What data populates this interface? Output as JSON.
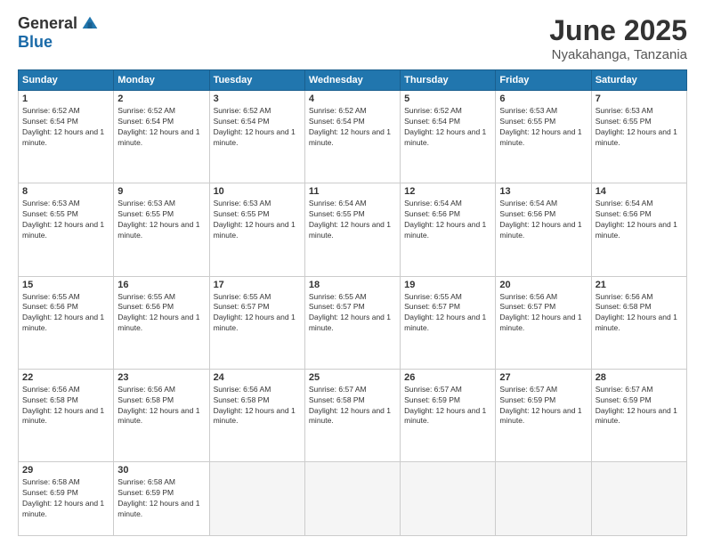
{
  "logo": {
    "general": "General",
    "blue": "Blue"
  },
  "title": "June 2025",
  "location": "Nyakahanga, Tanzania",
  "headers": [
    "Sunday",
    "Monday",
    "Tuesday",
    "Wednesday",
    "Thursday",
    "Friday",
    "Saturday"
  ],
  "weeks": [
    [
      {
        "day": "1",
        "sunrise": "6:52 AM",
        "sunset": "6:54 PM",
        "daylight": "12 hours and 1 minute."
      },
      {
        "day": "2",
        "sunrise": "6:52 AM",
        "sunset": "6:54 PM",
        "daylight": "12 hours and 1 minute."
      },
      {
        "day": "3",
        "sunrise": "6:52 AM",
        "sunset": "6:54 PM",
        "daylight": "12 hours and 1 minute."
      },
      {
        "day": "4",
        "sunrise": "6:52 AM",
        "sunset": "6:54 PM",
        "daylight": "12 hours and 1 minute."
      },
      {
        "day": "5",
        "sunrise": "6:52 AM",
        "sunset": "6:54 PM",
        "daylight": "12 hours and 1 minute."
      },
      {
        "day": "6",
        "sunrise": "6:53 AM",
        "sunset": "6:55 PM",
        "daylight": "12 hours and 1 minute."
      },
      {
        "day": "7",
        "sunrise": "6:53 AM",
        "sunset": "6:55 PM",
        "daylight": "12 hours and 1 minute."
      }
    ],
    [
      {
        "day": "8",
        "sunrise": "6:53 AM",
        "sunset": "6:55 PM",
        "daylight": "12 hours and 1 minute."
      },
      {
        "day": "9",
        "sunrise": "6:53 AM",
        "sunset": "6:55 PM",
        "daylight": "12 hours and 1 minute."
      },
      {
        "day": "10",
        "sunrise": "6:53 AM",
        "sunset": "6:55 PM",
        "daylight": "12 hours and 1 minute."
      },
      {
        "day": "11",
        "sunrise": "6:54 AM",
        "sunset": "6:55 PM",
        "daylight": "12 hours and 1 minute."
      },
      {
        "day": "12",
        "sunrise": "6:54 AM",
        "sunset": "6:56 PM",
        "daylight": "12 hours and 1 minute."
      },
      {
        "day": "13",
        "sunrise": "6:54 AM",
        "sunset": "6:56 PM",
        "daylight": "12 hours and 1 minute."
      },
      {
        "day": "14",
        "sunrise": "6:54 AM",
        "sunset": "6:56 PM",
        "daylight": "12 hours and 1 minute."
      }
    ],
    [
      {
        "day": "15",
        "sunrise": "6:55 AM",
        "sunset": "6:56 PM",
        "daylight": "12 hours and 1 minute."
      },
      {
        "day": "16",
        "sunrise": "6:55 AM",
        "sunset": "6:56 PM",
        "daylight": "12 hours and 1 minute."
      },
      {
        "day": "17",
        "sunrise": "6:55 AM",
        "sunset": "6:57 PM",
        "daylight": "12 hours and 1 minute."
      },
      {
        "day": "18",
        "sunrise": "6:55 AM",
        "sunset": "6:57 PM",
        "daylight": "12 hours and 1 minute."
      },
      {
        "day": "19",
        "sunrise": "6:55 AM",
        "sunset": "6:57 PM",
        "daylight": "12 hours and 1 minute."
      },
      {
        "day": "20",
        "sunrise": "6:56 AM",
        "sunset": "6:57 PM",
        "daylight": "12 hours and 1 minute."
      },
      {
        "day": "21",
        "sunrise": "6:56 AM",
        "sunset": "6:58 PM",
        "daylight": "12 hours and 1 minute."
      }
    ],
    [
      {
        "day": "22",
        "sunrise": "6:56 AM",
        "sunset": "6:58 PM",
        "daylight": "12 hours and 1 minute."
      },
      {
        "day": "23",
        "sunrise": "6:56 AM",
        "sunset": "6:58 PM",
        "daylight": "12 hours and 1 minute."
      },
      {
        "day": "24",
        "sunrise": "6:56 AM",
        "sunset": "6:58 PM",
        "daylight": "12 hours and 1 minute."
      },
      {
        "day": "25",
        "sunrise": "6:57 AM",
        "sunset": "6:58 PM",
        "daylight": "12 hours and 1 minute."
      },
      {
        "day": "26",
        "sunrise": "6:57 AM",
        "sunset": "6:59 PM",
        "daylight": "12 hours and 1 minute."
      },
      {
        "day": "27",
        "sunrise": "6:57 AM",
        "sunset": "6:59 PM",
        "daylight": "12 hours and 1 minute."
      },
      {
        "day": "28",
        "sunrise": "6:57 AM",
        "sunset": "6:59 PM",
        "daylight": "12 hours and 1 minute."
      }
    ],
    [
      {
        "day": "29",
        "sunrise": "6:58 AM",
        "sunset": "6:59 PM",
        "daylight": "12 hours and 1 minute."
      },
      {
        "day": "30",
        "sunrise": "6:58 AM",
        "sunset": "6:59 PM",
        "daylight": "12 hours and 1 minute."
      },
      null,
      null,
      null,
      null,
      null
    ]
  ],
  "labels": {
    "sunrise": "Sunrise:",
    "sunset": "Sunset:",
    "daylight": "Daylight:"
  }
}
